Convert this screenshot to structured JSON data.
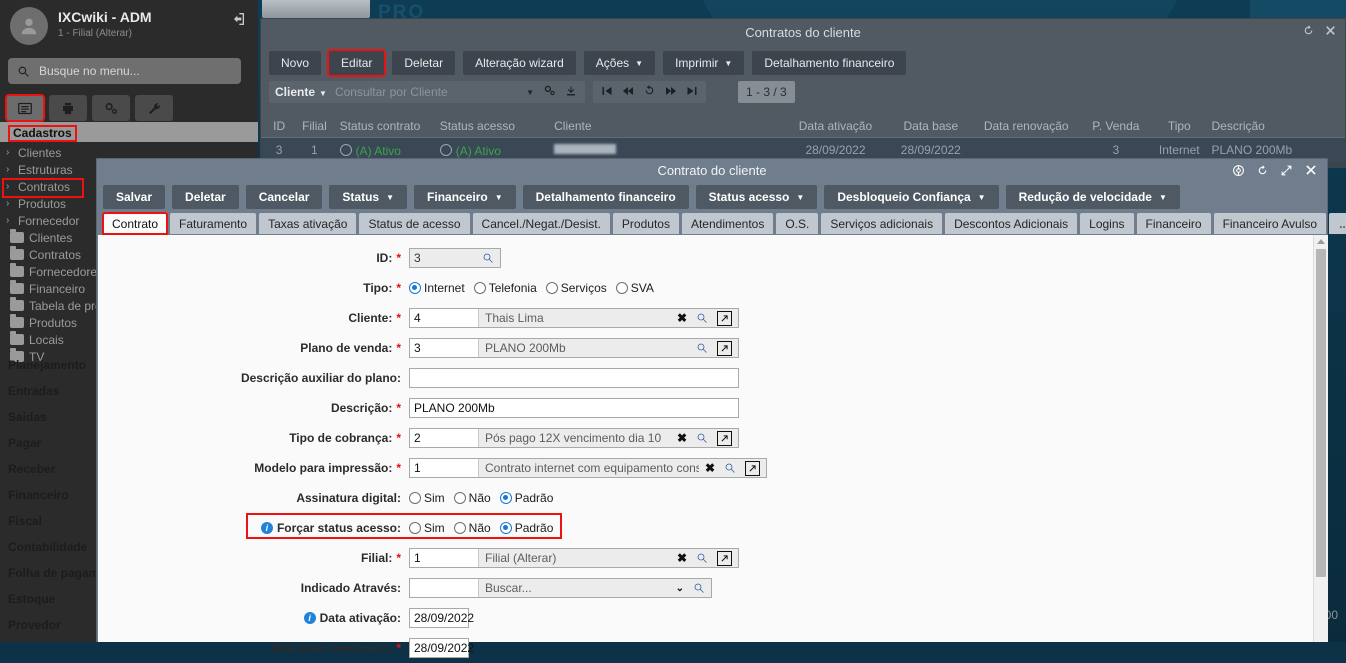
{
  "desktop": {
    "brand": "PRO",
    "amount_fragment": ",00"
  },
  "sidebar": {
    "user_name": "IXCwiki - ADM",
    "user_filial": "1 - Filial (Alterar)",
    "logout_icon": "logout-icon",
    "search_placeholder": "Busque no menu...",
    "search_icon": "search-icon",
    "icon_buttons": [
      {
        "name": "list-icon",
        "selected": true
      },
      {
        "name": "printer-icon",
        "selected": false
      },
      {
        "name": "gears-icon",
        "selected": false
      },
      {
        "name": "wrench-icon",
        "selected": false
      }
    ],
    "section_title": "Cadastros",
    "tree": [
      {
        "label": "Clientes",
        "type": "chevron",
        "highlighted": false
      },
      {
        "label": "Estruturas",
        "type": "chevron",
        "highlighted": false
      },
      {
        "label": "Contratos",
        "type": "chevron",
        "highlighted": true
      },
      {
        "label": "Produtos",
        "type": "chevron",
        "highlighted": false
      },
      {
        "label": "Fornecedor",
        "type": "chevron",
        "highlighted": false
      },
      {
        "label": "Clientes",
        "type": "folder",
        "highlighted": false
      },
      {
        "label": "Contratos",
        "type": "folder",
        "highlighted": false
      },
      {
        "label": "Fornecedores",
        "type": "folder",
        "highlighted": false
      },
      {
        "label": "Financeiro",
        "type": "folder",
        "highlighted": false
      },
      {
        "label": "Tabela de preço",
        "type": "folder",
        "highlighted": false
      },
      {
        "label": "Produtos",
        "type": "folder",
        "highlighted": false
      },
      {
        "label": "Locais",
        "type": "folder",
        "highlighted": false
      },
      {
        "label": "TV",
        "type": "folder",
        "highlighted": false
      }
    ],
    "main_menu": [
      {
        "label": "Planejamento"
      },
      {
        "label": "Entradas"
      },
      {
        "label": "Saidas"
      },
      {
        "label": "Pagar"
      },
      {
        "label": "Receber"
      },
      {
        "label": "Financeiro"
      },
      {
        "label": "Fiscal"
      },
      {
        "label": "Contabilidade"
      },
      {
        "label": "Folha de pagamento"
      },
      {
        "label": "Estoque"
      },
      {
        "label": "Provedor"
      }
    ]
  },
  "bg_window": {
    "title": "Contratos do cliente",
    "title_icons": [
      {
        "name": "history-icon"
      },
      {
        "name": "close-icon"
      }
    ],
    "toolbar": [
      {
        "label": "Novo",
        "highlighted": false,
        "dropdown": false
      },
      {
        "label": "Editar",
        "highlighted": true,
        "dropdown": false
      },
      {
        "label": "Deletar",
        "highlighted": false,
        "dropdown": false
      },
      {
        "label": "Alteração wizard",
        "highlighted": false,
        "dropdown": false
      },
      {
        "label": "Ações",
        "highlighted": false,
        "dropdown": true
      },
      {
        "label": "Imprimir",
        "highlighted": false,
        "dropdown": true
      },
      {
        "label": "Detalhamento financeiro",
        "highlighted": false,
        "dropdown": false
      }
    ],
    "filter": {
      "field_label": "Cliente",
      "placeholder": "Consultar por Cliente",
      "icons": [
        "settings-icon",
        "download-icon"
      ]
    },
    "pager": {
      "icons": [
        "first-page-icon",
        "prev-page-icon",
        "refresh-icon",
        "next-page-icon",
        "last-page-icon"
      ],
      "count_label": "1 - 3 / 3"
    },
    "table": {
      "columns": [
        "ID",
        "Filial",
        "Status contrato",
        "Status acesso",
        "Cliente",
        "Data ativação",
        "Data base",
        "Data renovação",
        "P. Venda",
        "Tipo",
        "Descrição"
      ],
      "rows": [
        {
          "id": "3",
          "filial": "1",
          "status_contrato": "(A) Ativo",
          "status_acesso": "(A) Ativo",
          "cliente": "",
          "data_ativacao": "28/09/2022",
          "data_base": "28/09/2022",
          "data_renovacao": "",
          "p_venda": "3",
          "tipo": "Internet",
          "descricao": "PLANO 200Mb"
        }
      ]
    }
  },
  "modal": {
    "title": "Contrato do cliente",
    "title_icons": [
      {
        "name": "help-icon"
      },
      {
        "name": "history-icon"
      },
      {
        "name": "expand-icon"
      },
      {
        "name": "close-icon"
      }
    ],
    "toolbar": [
      {
        "label": "Salvar",
        "dropdown": false
      },
      {
        "label": "Deletar",
        "dropdown": false
      },
      {
        "label": "Cancelar",
        "dropdown": false
      },
      {
        "label": "Status",
        "dropdown": true
      },
      {
        "label": "Financeiro",
        "dropdown": true
      },
      {
        "label": "Detalhamento financeiro",
        "dropdown": false
      },
      {
        "label": "Status acesso",
        "dropdown": true
      },
      {
        "label": "Desbloqueio Confiança",
        "dropdown": true
      },
      {
        "label": "Redução de velocidade",
        "dropdown": true
      }
    ],
    "tabs": [
      {
        "label": "Contrato",
        "active": true
      },
      {
        "label": "Faturamento",
        "active": false
      },
      {
        "label": "Taxas ativação",
        "active": false
      },
      {
        "label": "Status de acesso",
        "active": false
      },
      {
        "label": "Cancel./Negat./Desist.",
        "active": false
      },
      {
        "label": "Produtos",
        "active": false
      },
      {
        "label": "Atendimentos",
        "active": false
      },
      {
        "label": "O.S.",
        "active": false
      },
      {
        "label": "Serviços adicionais",
        "active": false
      },
      {
        "label": "Descontos Adicionais",
        "active": false
      },
      {
        "label": "Logins",
        "active": false
      },
      {
        "label": "Financeiro",
        "active": false
      },
      {
        "label": "Financeiro Avulso",
        "active": false
      },
      {
        "label": "...",
        "active": false
      }
    ],
    "form": {
      "id": {
        "label": "ID:",
        "required": true,
        "value": "3",
        "search_icon": "search-icon"
      },
      "tipo": {
        "label": "Tipo:",
        "required": true,
        "options": [
          {
            "label": "Internet",
            "selected": true
          },
          {
            "label": "Telefonia",
            "selected": false
          },
          {
            "label": "Serviços",
            "selected": false
          },
          {
            "label": "SVA",
            "selected": false
          }
        ]
      },
      "cliente": {
        "label": "Cliente:",
        "required": true,
        "key": "4",
        "desc": "Thais Lima",
        "actions": [
          "clear-icon",
          "search-icon",
          "open-external-icon"
        ]
      },
      "plano_venda": {
        "label": "Plano de venda:",
        "required": true,
        "key": "3",
        "desc": "PLANO 200Mb",
        "actions": [
          "search-icon",
          "open-external-icon"
        ]
      },
      "desc_auxiliar": {
        "label": "Descrição auxiliar do plano:",
        "required": false,
        "value": ""
      },
      "descricao": {
        "label": "Descrição:",
        "required": true,
        "value": "PLANO 200Mb"
      },
      "tipo_cobranca": {
        "label": "Tipo de cobrança:",
        "required": true,
        "key": "2",
        "desc": "Pós pago 12X vencimento dia 10",
        "actions": [
          "clear-icon",
          "search-icon",
          "open-external-icon"
        ]
      },
      "modelo_impressao": {
        "label": "Modelo para impressão:",
        "required": true,
        "key": "1",
        "desc": "Contrato internet com equipamento consign",
        "actions": [
          "clear-icon",
          "search-icon",
          "open-external-icon"
        ]
      },
      "assinatura_digital": {
        "label": "Assinatura digital:",
        "required": false,
        "options": [
          {
            "label": "Sim",
            "selected": false
          },
          {
            "label": "Não",
            "selected": false
          },
          {
            "label": "Padrão",
            "selected": true
          }
        ]
      },
      "forcar_status_acesso": {
        "label": "Forçar status acesso:",
        "required": false,
        "info": true,
        "highlighted": true,
        "options": [
          {
            "label": "Sim",
            "selected": false
          },
          {
            "label": "Não",
            "selected": false
          },
          {
            "label": "Padrão",
            "selected": true
          }
        ]
      },
      "filial": {
        "label": "Filial:",
        "required": true,
        "key": "1",
        "desc": "Filial (Alterar)",
        "actions": [
          "clear-icon",
          "search-icon",
          "open-external-icon"
        ]
      },
      "indicado_atraves": {
        "label": "Indicado Através:",
        "required": false,
        "key": "",
        "desc": "Buscar...",
        "actions": [
          "chevron-down-icon",
          "search-icon"
        ]
      },
      "data_ativacao": {
        "label": "Data ativação:",
        "required": false,
        "info": true,
        "value": "28/09/2022"
      },
      "data_base_financeiro": {
        "label": "Data base financeiro:",
        "required": true,
        "value": "28/09/2022"
      }
    }
  }
}
